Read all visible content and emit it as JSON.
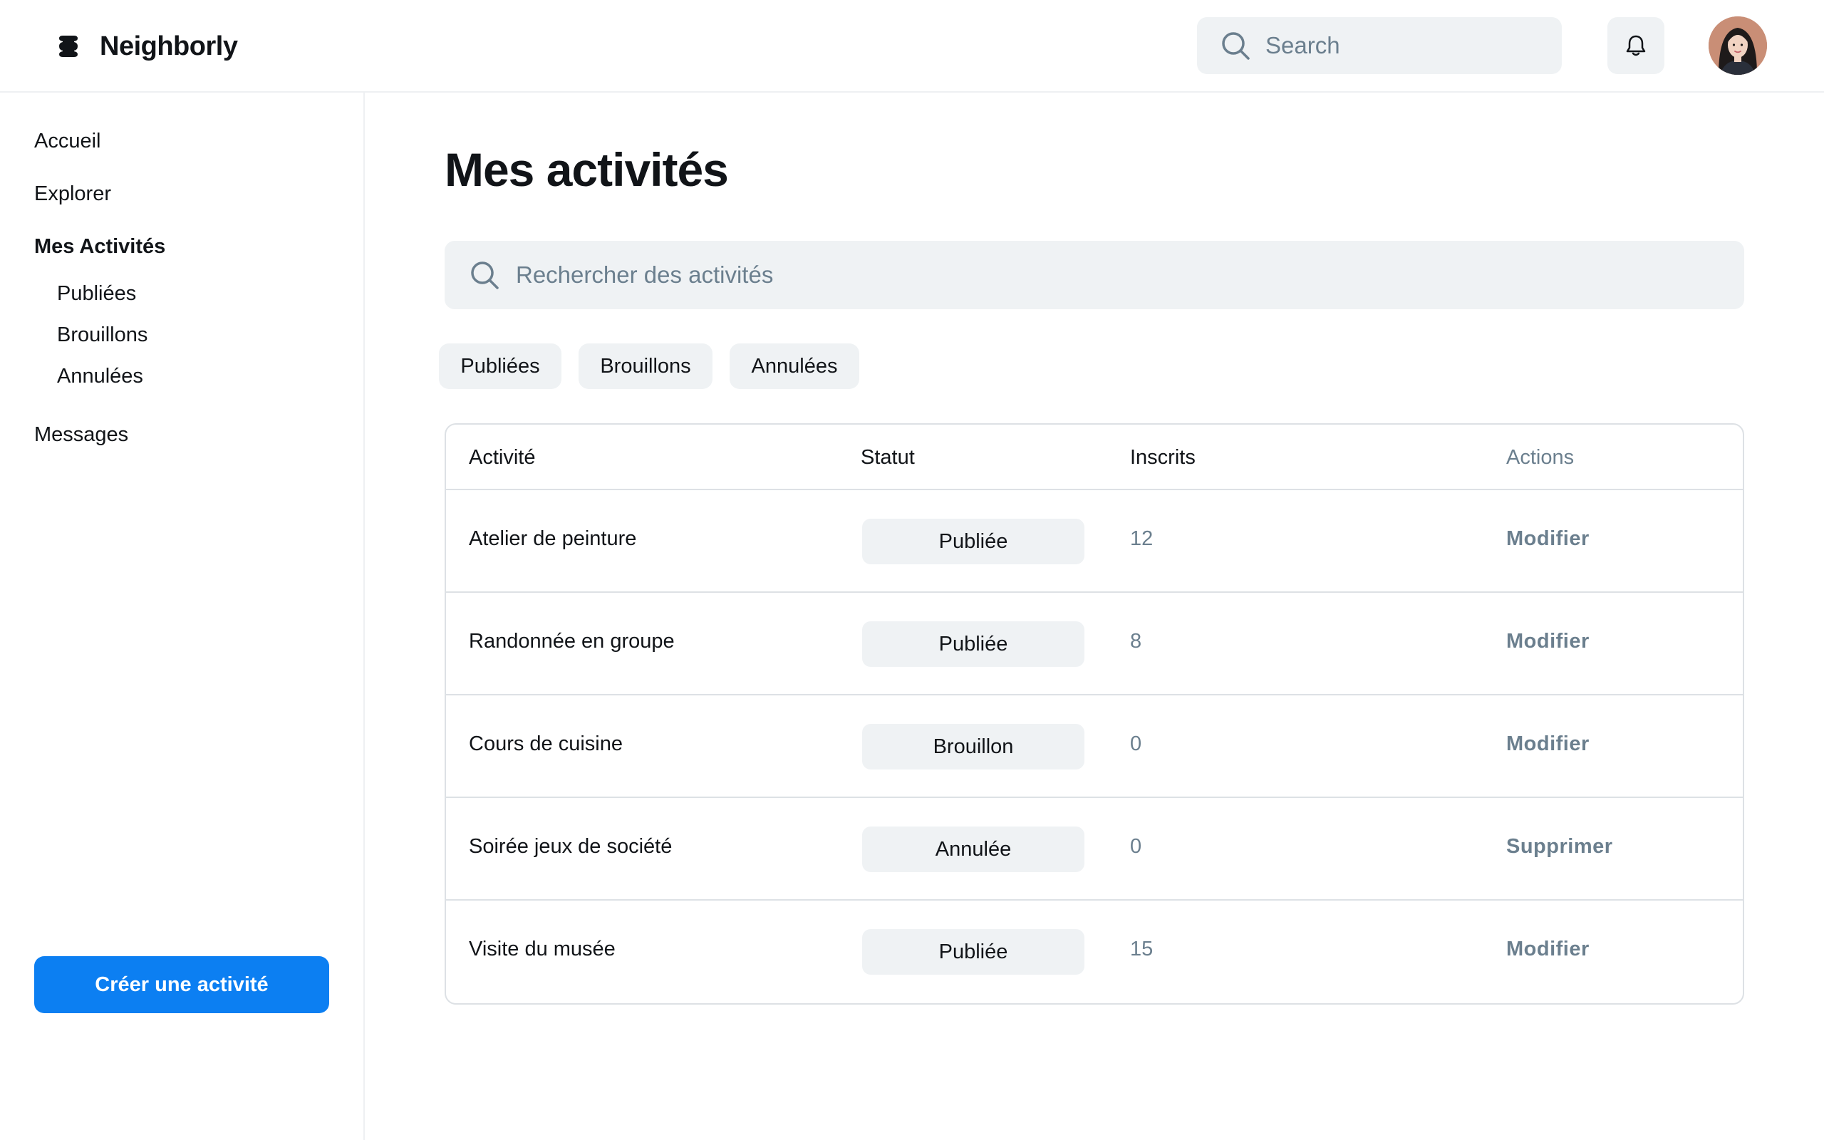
{
  "header": {
    "brand_name": "Neighborly",
    "search_placeholder": "Search",
    "icons": {
      "logo": "stack-logo-icon",
      "search": "search-icon",
      "notifications": "bell-icon",
      "avatar": "user-avatar"
    }
  },
  "sidebar": {
    "items": [
      {
        "label": "Accueil"
      },
      {
        "label": "Explorer"
      },
      {
        "label": "Mes Activités",
        "active": true
      },
      {
        "label": "Messages"
      }
    ],
    "subitems": [
      {
        "label": "Publiées"
      },
      {
        "label": "Brouillons"
      },
      {
        "label": "Annulées"
      }
    ],
    "create_button": "Créer une activité"
  },
  "main": {
    "title": "Mes activités",
    "search_placeholder": "Rechercher des activités",
    "filters": [
      "Publiées",
      "Brouillons",
      "Annulées"
    ],
    "table": {
      "headers": {
        "activity": "Activité",
        "status": "Statut",
        "registered": "Inscrits",
        "actions": "Actions"
      },
      "rows": [
        {
          "name": "Atelier de peinture",
          "status": "Publiée",
          "count": "12",
          "action": "Modifier"
        },
        {
          "name": "Randonnée en groupe",
          "status": "Publiée",
          "count": "8",
          "action": "Modifier"
        },
        {
          "name": "Cours de cuisine",
          "status": "Brouillon",
          "count": "0",
          "action": "Modifier"
        },
        {
          "name": "Soirée jeux de société",
          "status": "Annulée",
          "count": "0",
          "action": "Supprimer"
        },
        {
          "name": "Visite du musée",
          "status": "Publiée",
          "count": "15",
          "action": "Modifier"
        }
      ]
    }
  },
  "colors": {
    "accent": "#0c7ff2",
    "surface": "#eff2f4",
    "muted_text": "#6b7f8e",
    "border": "#dde1e5",
    "text": "#111418"
  }
}
